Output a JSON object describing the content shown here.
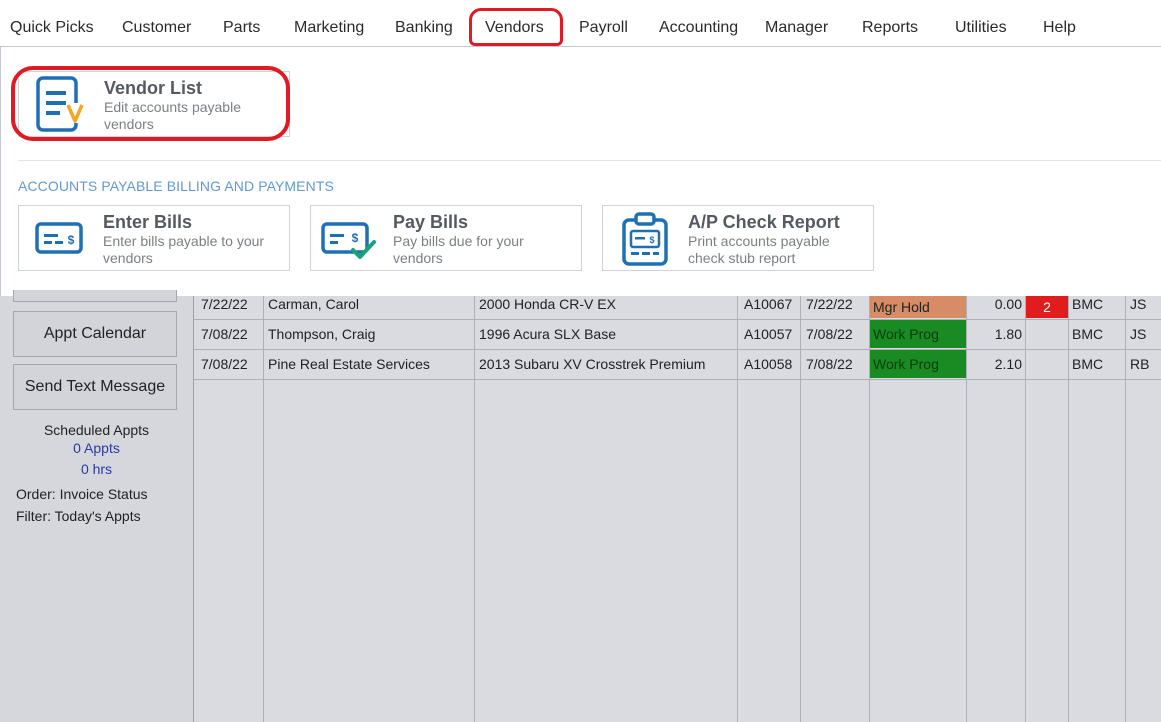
{
  "menu": {
    "items": [
      "Quick Picks",
      "Customer",
      "Parts",
      "Marketing",
      "Banking",
      "Vendors",
      "Payroll",
      "Accounting",
      "Manager",
      "Reports",
      "Utilities",
      "Help"
    ],
    "active": "Vendors"
  },
  "vendor_list": {
    "title": "Vendor List",
    "description": "Edit accounts payable vendors"
  },
  "section_label": "ACCOUNTS PAYABLE BILLING AND PAYMENTS",
  "cards": [
    {
      "title": "Enter Bills",
      "description": "Enter bills payable to your vendors"
    },
    {
      "title": "Pay Bills",
      "description": "Pay bills due for your vendors"
    },
    {
      "title": "A/P Check Report",
      "description": "Print accounts payable check stub report"
    }
  ],
  "sidebar": {
    "appt_calendar_label": "Appt Calendar",
    "send_text_label": "Send Text Message",
    "scheduled_label": "Scheduled Appts",
    "appts_value": "0 Appts",
    "hrs_value": "0 hrs",
    "order_text": "Order: Invoice Status",
    "filter_text": "Filter: Today's Appts"
  },
  "colors": {
    "accent_red": "#e01a22",
    "mgr_hold": "#d68d66",
    "work_prog": "#1a8a22",
    "badge_red": "#e11c1c",
    "icon_blue": "#1f6fb5",
    "icon_orange": "#f5a623",
    "icon_green": "#1aa37a",
    "section_blue": "#5f9ad4"
  },
  "rows": [
    {
      "date": "7/22/22",
      "customer": "Carman, Carol",
      "vehicle": "2000 Honda  CR-V EX",
      "invoice": "A10067",
      "promised": "7/22/22",
      "status": "Mgr Hold",
      "status_color": "#d68d66",
      "hours": "0.00",
      "flag": "2",
      "advisor": "BMC",
      "tech": "JS"
    },
    {
      "date": "7/08/22",
      "customer": "Thompson, Craig",
      "vehicle": "1996 Acura  SLX Base",
      "invoice": "A10057",
      "promised": "7/08/22",
      "status": "Work Prog",
      "status_color": "#1a8a22",
      "hours": "1.80",
      "flag": "",
      "advisor": "BMC",
      "tech": "JS"
    },
    {
      "date": "7/08/22",
      "customer": "Pine Real Estate Services",
      "vehicle": "2013 Subaru  XV Crosstrek Premium",
      "invoice": "A10058",
      "promised": "7/08/22",
      "status": "Work Prog",
      "status_color": "#1a8a22",
      "hours": "2.10",
      "flag": "",
      "advisor": "BMC",
      "tech": "RB"
    }
  ]
}
